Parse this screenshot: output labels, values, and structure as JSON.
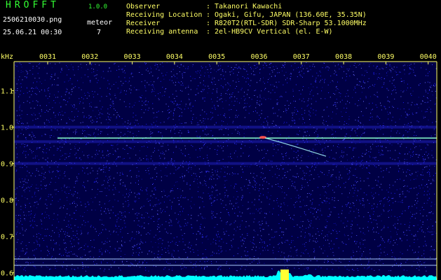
{
  "app": {
    "logo": "HROFFT",
    "version": "1.0.0",
    "file_name": "2506210030.png",
    "datetime": "25.06.21 00:30",
    "meteor_label": "meteor",
    "meteor_count": "7"
  },
  "info": [
    {
      "label": "Observer",
      "sep": ":",
      "value": "Takanori Kawachi"
    },
    {
      "label": "Receiving Location",
      "sep": ":",
      "value": "Ogaki, Gifu, JAPAN (136.60E, 35.35N)"
    },
    {
      "label": "Receiver",
      "sep": ":",
      "value": "R820T2(RTL-SDR) SDR-Sharp 53.1000MHz"
    },
    {
      "label": "Receiving antenna",
      "sep": ":",
      "value": "2el-HB9CV Vertical (el. E-W)"
    }
  ],
  "spectrogram": {
    "y_unit": "kHz",
    "y_ticks": [
      "1.1",
      "1.0",
      "0.9",
      "0.8",
      "0.7",
      "0.6"
    ],
    "y_tick_values": [
      1.1,
      1.0,
      0.9,
      0.8,
      0.7,
      0.6
    ],
    "y_range": [
      0.58,
      1.18
    ],
    "x_ticks": [
      "0031",
      "0032",
      "0033",
      "0034",
      "0035",
      "0036",
      "0037",
      "0038",
      "0039",
      "0040"
    ],
    "carrier_khz": 0.97,
    "colors": {
      "background": "#000044",
      "noise": "#2a2aff",
      "axis": "#ffff66",
      "carrier": "#88ffcc",
      "meteor": "#ff5050",
      "baseline": "#00ffff"
    }
  }
}
